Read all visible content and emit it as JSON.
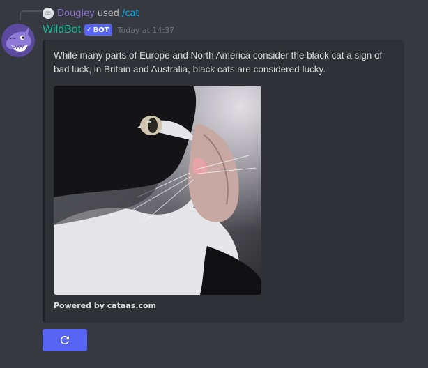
{
  "usage": {
    "user": "Dougley",
    "verb": "used",
    "command": "/cat"
  },
  "message": {
    "author": "WildBot",
    "tag": "BOT",
    "timestamp": "Today at 14:37"
  },
  "embed": {
    "description": "While many parts of Europe and North America consider the black cat a sign of bad luck, in Britain and Australia, black cats are considered lucky.",
    "footer": "Powered by cataas.com"
  },
  "colors": {
    "background": "#36393f",
    "embed_background": "#2f3136",
    "bot_name": "#1abc9c",
    "blurple": "#5865f2",
    "usage_user": "#8e6fd6",
    "command": "#00aff4"
  },
  "icons": {
    "refresh_button_icon": "refresh-icon",
    "bot_tag_check": "checkmark-icon"
  }
}
